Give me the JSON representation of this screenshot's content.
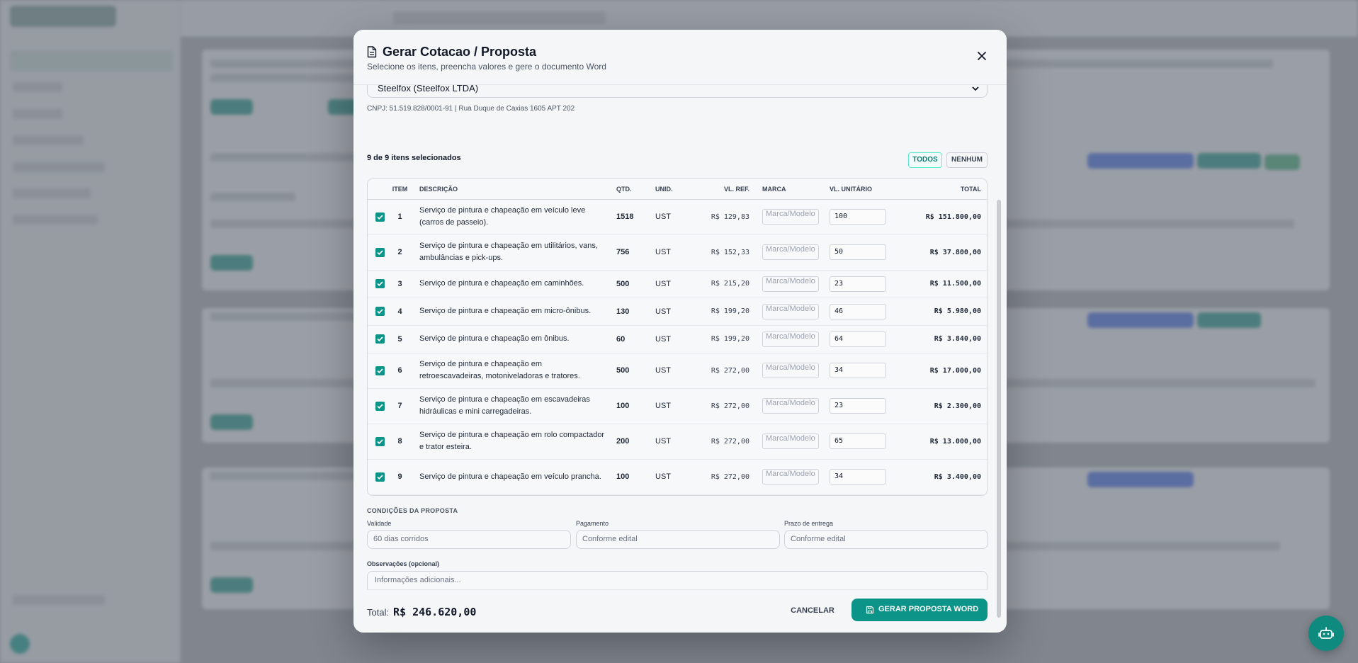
{
  "modal": {
    "title": "Gerar Cotacao / Proposta",
    "subtitle": "Selecione os itens, preencha valores e gere o documento Word"
  },
  "supplier": {
    "selected": "Steelfox (Steelfox LTDA)",
    "info": "CNPJ: 51.519.828/0001-91 | Rua Duque de Caxias 1605 APT 202"
  },
  "selection": {
    "count_text": "9 de 9 itens selecionados",
    "all_label": "TODOS",
    "none_label": "NENHUM"
  },
  "table": {
    "headers": {
      "item": "ITEM",
      "descricao": "DESCRIÇÃO",
      "qtd": "QTD.",
      "unid": "UNID.",
      "vl_ref": "VL. REF.",
      "marca": "MARCA",
      "vl_unitario": "VL. UNITÁRIO",
      "total": "TOTAL"
    },
    "marca_placeholder": "Marca/Modelo",
    "rows": [
      {
        "checked": true,
        "item": "1",
        "descricao": "Serviço de pintura e chapeação em veículo leve (carros de passeio).",
        "qtd": "1518",
        "unid": "UST",
        "vl_ref": "R$ 129,83",
        "vl_unitario": "100",
        "total": "R$ 151.800,00"
      },
      {
        "checked": true,
        "item": "2",
        "descricao": "Serviço de pintura e chapeação em utilitários, vans, ambulâncias e pick-ups.",
        "qtd": "756",
        "unid": "UST",
        "vl_ref": "R$ 152,33",
        "vl_unitario": "50",
        "total": "R$ 37.800,00"
      },
      {
        "checked": true,
        "item": "3",
        "descricao": "Serviço de pintura e chapeação em caminhões.",
        "qtd": "500",
        "unid": "UST",
        "vl_ref": "R$ 215,20",
        "vl_unitario": "23",
        "total": "R$ 11.500,00"
      },
      {
        "checked": true,
        "item": "4",
        "descricao": "Serviço de pintura e chapeação em micro-ônibus.",
        "qtd": "130",
        "unid": "UST",
        "vl_ref": "R$ 199,20",
        "vl_unitario": "46",
        "total": "R$ 5.980,00"
      },
      {
        "checked": true,
        "item": "5",
        "descricao": "Serviço de pintura e chapeação em ônibus.",
        "qtd": "60",
        "unid": "UST",
        "vl_ref": "R$ 199,20",
        "vl_unitario": "64",
        "total": "R$ 3.840,00"
      },
      {
        "checked": true,
        "item": "6",
        "descricao": "Serviço de pintura e chapeação em retroescavadeiras, motoniveladoras e tratores.",
        "qtd": "500",
        "unid": "UST",
        "vl_ref": "R$ 272,00",
        "vl_unitario": "34",
        "total": "R$ 17.000,00"
      },
      {
        "checked": true,
        "item": "7",
        "descricao": "Serviço de pintura e chapeação em escavadeiras hidráulicas e mini carregadeiras.",
        "qtd": "100",
        "unid": "UST",
        "vl_ref": "R$ 272,00",
        "vl_unitario": "23",
        "total": "R$ 2.300,00"
      },
      {
        "checked": true,
        "item": "8",
        "descricao": "Serviço de pintura e chapeação em rolo compactador e trator esteira.",
        "qtd": "200",
        "unid": "UST",
        "vl_ref": "R$ 272,00",
        "vl_unitario": "65",
        "total": "R$ 13.000,00"
      },
      {
        "checked": true,
        "item": "9",
        "descricao": "Serviço de pintura e chapeação em veículo prancha.",
        "qtd": "100",
        "unid": "UST",
        "vl_ref": "R$ 272,00",
        "vl_unitario": "34",
        "total": "R$ 3.400,00"
      }
    ]
  },
  "conditions": {
    "section_title": "CONDIÇÕES DA PROPOSTA",
    "validade_label": "Validade",
    "validade_placeholder": "60 dias corridos",
    "pagamento_label": "Pagamento",
    "pagamento_placeholder": "Conforme edital",
    "prazo_label": "Prazo de entrega",
    "prazo_placeholder": "Conforme edital",
    "obs_label": "Observações (opcional)",
    "obs_placeholder": "Informações adicionais..."
  },
  "footer": {
    "total_label": "Total:",
    "total_value": "R$ 246.620,00",
    "cancel_label": "CANCELAR",
    "generate_label": "GERAR PROPOSTA WORD"
  },
  "colors": {
    "accent": "#0d9488",
    "overlay": "#9aa0a8"
  },
  "icons": [
    "document-icon",
    "close-icon",
    "chevron-down-icon",
    "checkbox-checked-icon",
    "save-icon",
    "robot-icon"
  ]
}
